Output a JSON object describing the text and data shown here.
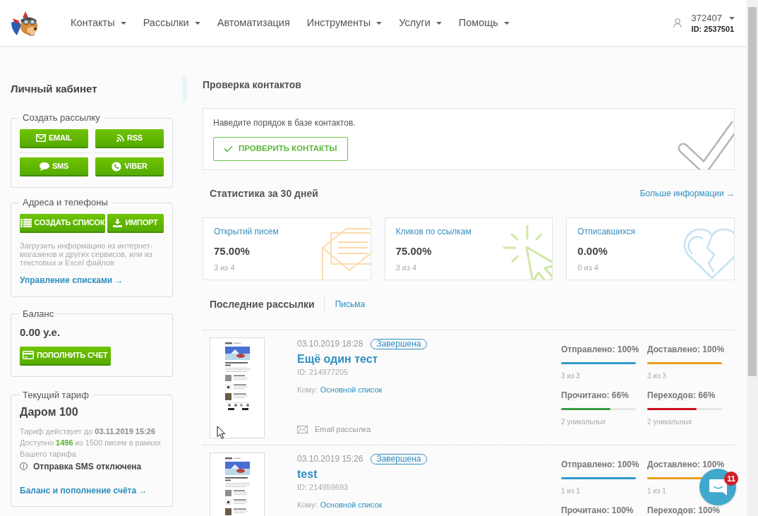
{
  "header": {
    "nav": [
      {
        "label": "Контакты",
        "dropdown": true
      },
      {
        "label": "Рассылки",
        "dropdown": true
      },
      {
        "label": "Автоматизация",
        "dropdown": false
      },
      {
        "label": "Инструменты",
        "dropdown": true
      },
      {
        "label": "Услуги",
        "dropdown": true
      },
      {
        "label": "Помощь",
        "dropdown": true
      }
    ],
    "account": {
      "login": "372407",
      "id": "ID: 2537501",
      "dropdown": true
    }
  },
  "sidebar": {
    "title": "Личный кабинет",
    "create_campaign": {
      "legend": "Создать рассылку",
      "buttons": [
        {
          "kind": "email",
          "label": "EMAIL"
        },
        {
          "kind": "rss",
          "label": "RSS"
        },
        {
          "kind": "sms",
          "label": "SMS"
        },
        {
          "kind": "viber",
          "label": "VIBER"
        }
      ]
    },
    "contacts": {
      "legend": "Адреса и телефоны",
      "buttons": [
        {
          "kind": "list",
          "label": "СОЗДАТЬ СПИСОК"
        },
        {
          "kind": "import",
          "label": "ИМПОРТ"
        }
      ],
      "note": "Загрузить информацию из интернет-магазинов и других сервисов, или из текстовых и Excel файлов",
      "link": "Управление списками →"
    },
    "balance": {
      "legend": "Баланс",
      "amount": "0.00 у.е.",
      "button": {
        "kind": "card",
        "label": "ПОПОЛНИТЬ СЧЕТ"
      }
    },
    "tariff": {
      "legend": "Текущий тариф",
      "name": "Даром 100",
      "valid_until": "Тариф действует до **03.11.2019 15:26**",
      "available": "Доступно **1496** из 1500 писем в рамках Вашего тарифа",
      "sms_notice": "Отправка SMS отключена",
      "link": "Баланс и пополнение счёта →"
    }
  },
  "contact_check": {
    "title": "Проверка контактов",
    "text": "Наведите порядок в базе контактов.",
    "button": "ПРОВЕРИТЬ КОНТАКТЫ"
  },
  "stats": {
    "title": "Статистика за 30 дней",
    "more_link": "Больше информации →",
    "cards": [
      {
        "kind": "opens",
        "label": "Открытий писем",
        "value": "75.00%",
        "detail": "3 из 4"
      },
      {
        "kind": "clicks",
        "label": "Кликов по ссылкам",
        "value": "75.00%",
        "detail": "3 из 4"
      },
      {
        "kind": "unsubscribes",
        "label": "Отписавшихся",
        "value": "0.00%",
        "detail": "0 из 4"
      }
    ]
  },
  "recent": {
    "title": "Последние рассылки",
    "link": "Письма"
  },
  "campaigns": [
    {
      "date": "03.10.2019 18:28",
      "status": "Завершена",
      "name": "Ещё один тест",
      "id": "ID: 214977205",
      "recipients_label": "Кому:",
      "recipients": "Основной список",
      "type": "Email рассылка",
      "metrics": [
        {
          "label": "Отправлено: 100%",
          "level": 1,
          "color": "#3399cc",
          "detail": "3 из 3"
        },
        {
          "label": "Доставлено: 100%",
          "level": 1,
          "color": "#eb9f1e",
          "detail": "3 из 3"
        },
        {
          "label": "Прочитано: 66%",
          "level": 0.66,
          "color": "#3a9b45",
          "detail": "2 уникальных"
        },
        {
          "label": "Переходов: 66%",
          "level": 0.66,
          "color": "#cc1020",
          "detail": "2 уникальных"
        }
      ]
    },
    {
      "date": "03.10.2019 15:26",
      "status": "Завершена",
      "name": "test",
      "id": "ID: 214959693",
      "recipients_label": "Кому:",
      "recipients": "Основной список",
      "metrics": [
        {
          "label": "Отправлено: 100%",
          "level": 1,
          "color": "#3399cc",
          "detail": "1 из 1"
        },
        {
          "label": "Доставлено: 100%",
          "level": 1,
          "color": "#eb9f1e",
          "detail": "1 из 1"
        },
        {
          "label": "Прочитано: 100%"
        },
        {
          "label": "Переходов: 100%"
        }
      ]
    }
  ],
  "chat": {
    "badge": "11"
  }
}
